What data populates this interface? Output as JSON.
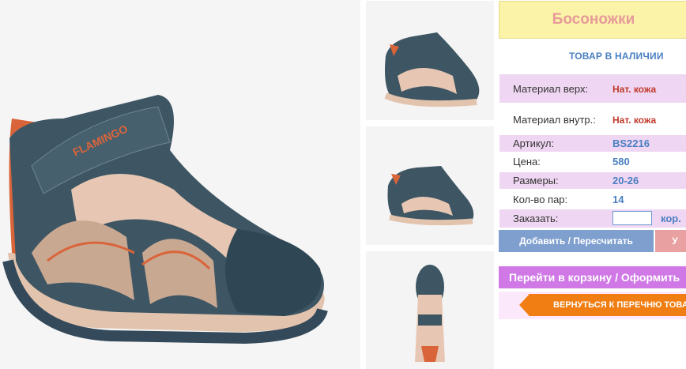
{
  "product": {
    "title": "Босоножки",
    "stock_status": "ТОВАР В НАЛИЧИИ",
    "brand_logo": "FLAMINGO"
  },
  "specs": {
    "material_top_label": "Материал верх:",
    "material_top_value": "Нат. кожа",
    "material_inner_label": "Материал внутр.:",
    "material_inner_value": "Нат. кожа",
    "article_label": "Артикул:",
    "article_value": "BS2216",
    "price_label": "Цена:",
    "price_value": "580",
    "sizes_label": "Размеры:",
    "sizes_value": "20-26",
    "pairs_label": "Кол-во пар:",
    "pairs_value": "14",
    "order_label": "Заказать:",
    "order_input_value": "",
    "order_unit": "кор."
  },
  "actions": {
    "add_label": "Добавить / Пересчитать",
    "delete_label": "У",
    "cart_label": "Перейти в корзину / Оформить",
    "back_label": "ВЕРНУТЬСЯ К ПЕРЕЧНЮ ТОВАРОВ"
  },
  "colors": {
    "title_bg": "#fbf3a7",
    "title_text": "#e79a9a",
    "accent_blue": "#4a7fc1",
    "spec_row_pink": "#efd6f2",
    "cart_button": "#cf78e6",
    "back_button": "#f07e12",
    "add_button": "#7f9fcf",
    "shoe_leather": "#3e5663",
    "shoe_beige": "#e7c7b3",
    "shoe_orange": "#d9643a"
  }
}
